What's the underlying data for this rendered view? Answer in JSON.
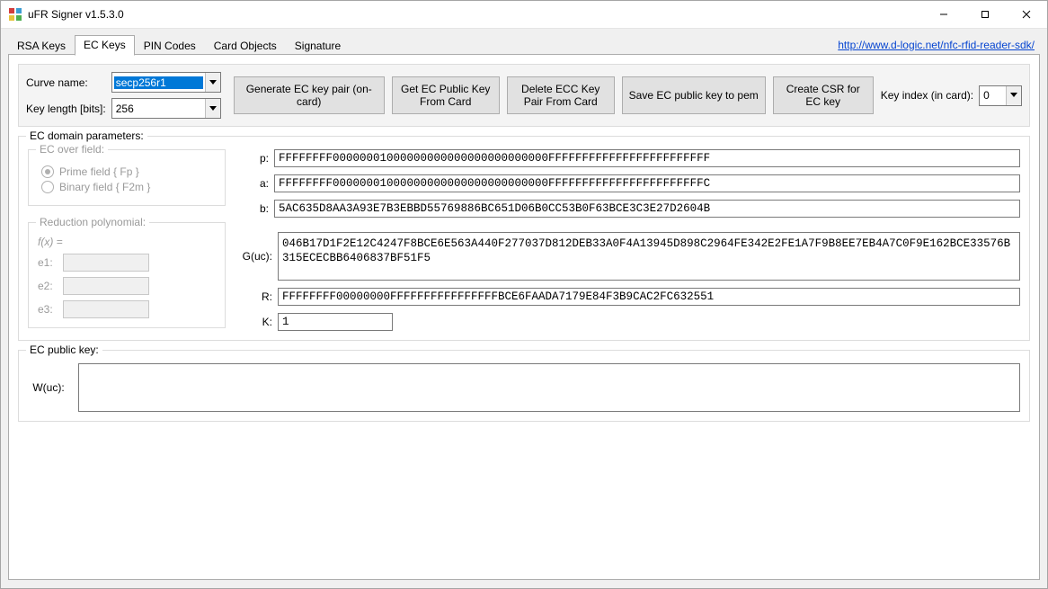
{
  "titlebar": {
    "title": "uFR Signer v1.5.3.0"
  },
  "link": {
    "text": "http://www.d-logic.net/nfc-rfid-reader-sdk/",
    "href": "http://www.d-logic.net/nfc-rfid-reader-sdk/"
  },
  "tabs": [
    {
      "label": "RSA Keys"
    },
    {
      "label": "EC Keys"
    },
    {
      "label": "PIN Codes"
    },
    {
      "label": "Card Objects"
    },
    {
      "label": "Signature"
    }
  ],
  "top": {
    "curve_label": "Curve name:",
    "curve_value": "secp256r1",
    "keylen_label": "Key length [bits]:",
    "keylen_value": "256",
    "btn_generate": "Generate EC key pair (on-card)",
    "btn_getpub": "Get EC Public Key From Card",
    "btn_delete": "Delete ECC Key Pair From Card",
    "btn_savepem": "Save EC public key to pem",
    "btn_csr": "Create CSR for EC key",
    "keyindex_label": "Key index (in card):",
    "keyindex_value": "0"
  },
  "domain": {
    "legend": "EC domain parameters:",
    "overfield_legend": "EC over field:",
    "radio_prime": "Prime field { Fp }",
    "radio_binary": "Binary field { F2m }",
    "redpoly_legend": "Reduction polynomial:",
    "fx_label": "f(x) =",
    "e1_label": "e1:",
    "e2_label": "e2:",
    "e3_label": "e3:",
    "p_label": "p:",
    "p_value": "FFFFFFFF00000001000000000000000000000000FFFFFFFFFFFFFFFFFFFFFFFF",
    "a_label": "a:",
    "a_value": "FFFFFFFF00000001000000000000000000000000FFFFFFFFFFFFFFFFFFFFFFFC",
    "b_label": "b:",
    "b_value": "5AC635D8AA3A93E7B3EBBD55769886BC651D06B0CC53B0F63BCE3C3E27D2604B",
    "g_label": "G(uc):",
    "g_value": "046B17D1F2E12C4247F8BCE6E563A440F277037D812DEB33A0F4A13945D898C2964FE342E2FE1A7F9B8EE7EB4A7C0F9E162BCE33576B315ECECBB6406837BF51F5",
    "r_label": "R:",
    "r_value": "FFFFFFFF00000000FFFFFFFFFFFFFFFFBCE6FAADA7179E84F3B9CAC2FC632551",
    "k_label": "K:",
    "k_value": "1"
  },
  "pubkey": {
    "legend": "EC public key:",
    "w_label": "W(uc):",
    "w_value": ""
  }
}
